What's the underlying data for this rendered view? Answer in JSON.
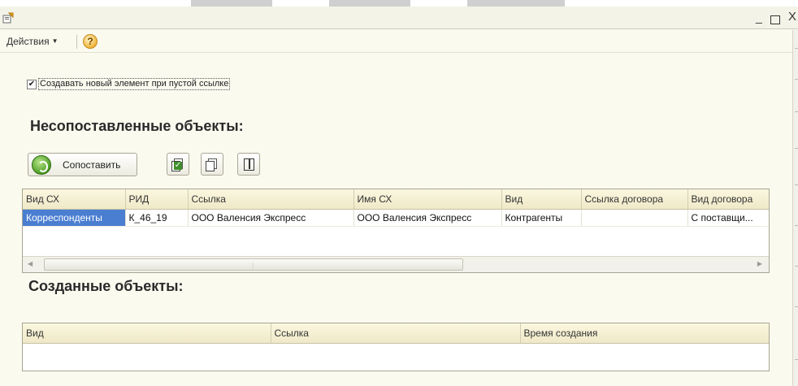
{
  "window": {
    "app_icon": "1c-form-icon",
    "controls": {
      "minimize": "_",
      "close": "X"
    }
  },
  "command_bar": {
    "actions_label": "Действия",
    "help_icon": "help-icon",
    "help_glyph": "?"
  },
  "form": {
    "checkbox": {
      "label": "Создавать новый элемент при пустой ссылке",
      "checked": true,
      "check_glyph": "✔"
    },
    "unmatched_title": "Несопоставленные объекты:",
    "match_button_label": "Сопоставить",
    "toolbar_icons": [
      "check-all-icon",
      "uncheck-all-icon",
      "columns-icon"
    ],
    "created_title": "Созданные объекты:"
  },
  "unmatched_grid": {
    "columns": [
      "Вид СХ",
      "РИД",
      "Ссылка",
      "Имя СХ",
      "Вид",
      "Ссылка договора",
      "Вид договора"
    ],
    "rows": [
      [
        "Корреспонденты",
        "К_46_19",
        "ООО Валенсия Экспресс",
        "ООО Валенсия Экспресс",
        "Контрагенты",
        "",
        "С поставщи..."
      ]
    ]
  },
  "created_grid": {
    "columns": [
      "Вид",
      "Ссылка",
      "Время создания"
    ],
    "rows": []
  },
  "colors": {
    "background": "#fbfaef",
    "selection": "#4a7ed1",
    "header": "#efe9c8"
  }
}
